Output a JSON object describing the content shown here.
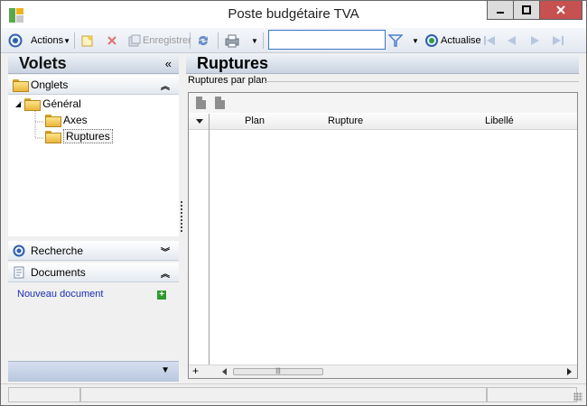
{
  "window": {
    "title": "Poste budgétaire TVA",
    "controls": [
      "minimize-icon",
      "maximize-icon",
      "close-icon"
    ]
  },
  "toolbar": {
    "actions_label": "Actions",
    "enregistrer_label": "Enregistrer",
    "search_value": "",
    "actualise_label": "Actualise",
    "icons": [
      "actions-icon",
      "new-icon",
      "delete-icon",
      "save-icon",
      "refresh-icon",
      "print-icon",
      "filter-icon",
      "actualise-icon",
      "first-icon",
      "prev-icon",
      "next-icon",
      "last-icon"
    ]
  },
  "left": {
    "header_title": "Volets",
    "collapse_glyph": "«",
    "onglets_label": "Onglets",
    "tree": {
      "root": "Général",
      "children": [
        "Axes",
        "Ruptures"
      ],
      "selected": "Ruptures"
    },
    "recherche_label": "Recherche",
    "documents_label": "Documents",
    "new_document_link": "Nouveau document"
  },
  "right": {
    "header_title": "Ruptures",
    "group_label": "Ruptures par plan",
    "columns": [
      "Plan",
      "Rupture",
      "Libellé"
    ],
    "rows": []
  },
  "colors": {
    "accent": "#3b77c7",
    "close_button": "#c75050",
    "link": "#1a2fb5",
    "folder": "#e9b53b"
  }
}
